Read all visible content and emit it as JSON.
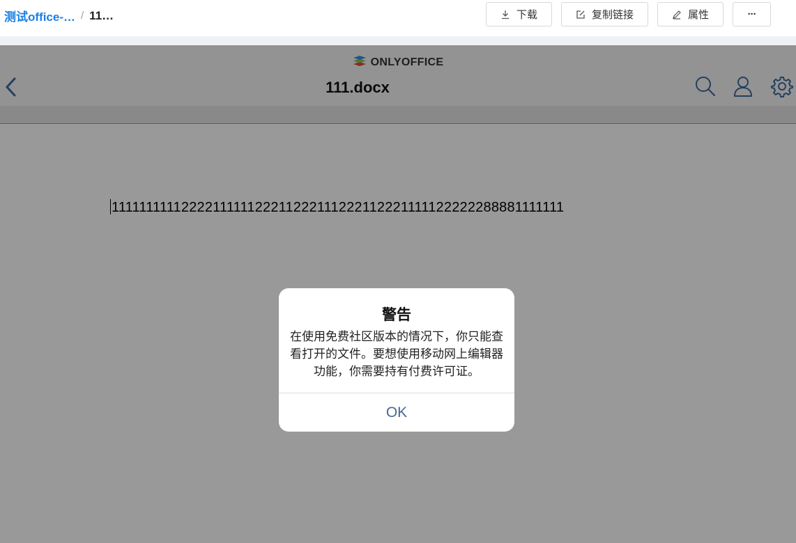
{
  "breadcrumb": {
    "parent": "测试office-…",
    "separator": "/",
    "current": "11…"
  },
  "toolbar": {
    "download_label": "下载",
    "copy_link_label": "复制链接",
    "properties_label": "属性",
    "more_label": "···"
  },
  "editor": {
    "brand": "ONLYOFFICE",
    "title": "111.docx",
    "content": "1111111111222211111122211222111222112221111122222288881111111"
  },
  "dialog": {
    "title": "警告",
    "message": "在使用免费社区版本的情况下，你只能查看打开的文件。要想使用移动网上编辑器功能，你需要持有付费许可证。",
    "ok_label": "OK"
  },
  "colors": {
    "link": "#1a7fe6",
    "dialog_button": "#446995",
    "brand_blue": "#3d8fd6",
    "icon": "#3f6a9b"
  }
}
